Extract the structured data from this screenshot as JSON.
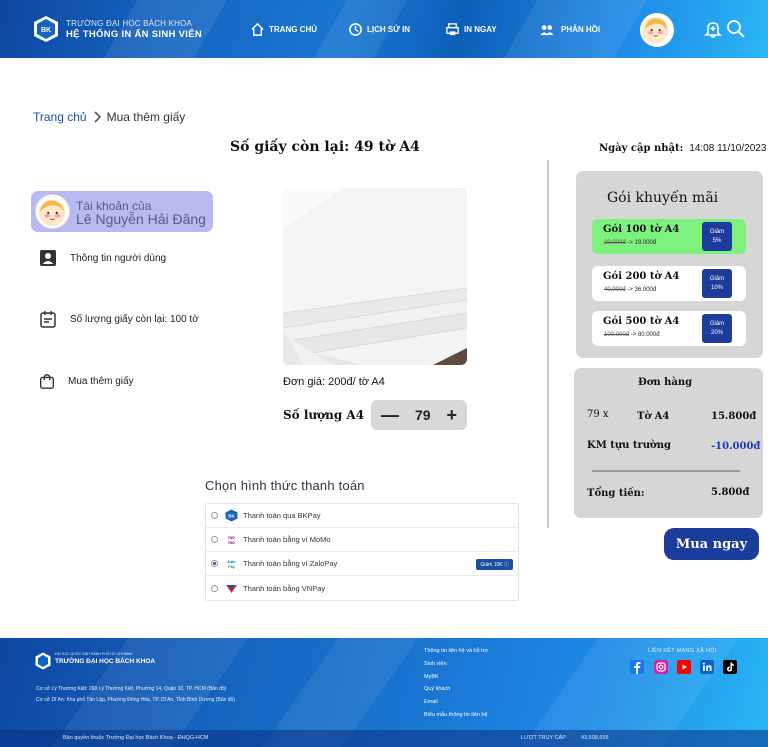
{
  "header": {
    "brand_line1": "TRƯỜNG ĐẠI HỌC BÁCH KHOA",
    "brand_line2": "HỆ THỐNG IN ẤN SINH VIÊN",
    "logo_text": "BK",
    "nav": {
      "home": "TRANG CHỦ",
      "history": "LỊCH SỬ IN",
      "print_now": "IN NGAY",
      "feedback": "PHẢN HỒI"
    }
  },
  "breadcrumb": {
    "home": "Trang chủ",
    "current": "Mua thêm giấy"
  },
  "summary": {
    "remaining": "Số giấy còn lại: 49 tờ A4",
    "updated_label": "Ngày cập nhật:",
    "updated_value": "14:08 11/10/2023"
  },
  "account": {
    "label": "Tài khoản của",
    "name": "Lê Nguyễn Hải Đăng"
  },
  "menu": {
    "user_info": "Thông tin người dùng",
    "paper_left": "Số lượng giấy còn lại: 100 tờ",
    "buy_more": "Mua thêm giấy"
  },
  "product": {
    "unit_price": "Đơn giá: 200đ/ tờ A4",
    "qty_label": "Số lượng A4",
    "qty_minus": "—",
    "qty_value": "79",
    "qty_plus": "+"
  },
  "payment": {
    "title": "Chọn hình thức thanh toán",
    "methods": [
      {
        "label": "Thanh toán qua BKPay",
        "selected": false
      },
      {
        "label": "Thanh toán bằng ví MoMo",
        "selected": false
      },
      {
        "label": "Thanh toán bằng ví ZaloPay",
        "selected": true,
        "promo": "Giảm 10K ⓘ"
      },
      {
        "label": "Thanh toán bằng VNPay",
        "selected": false
      }
    ]
  },
  "promo": {
    "title": "Gói khuyến mãi",
    "packs": [
      {
        "name": "Gói 100 tờ A4",
        "old": "20.000đ",
        "new": "-> 19.000đ",
        "disc1": "Giảm",
        "disc2": "5%",
        "selected": true
      },
      {
        "name": "Gói 200 tờ A4",
        "old": "40.000đ",
        "new": "-> 36.000đ",
        "disc1": "Giảm",
        "disc2": "10%",
        "selected": false
      },
      {
        "name": "Gói 500 tờ A4",
        "old": "100.000đ",
        "new": "-> 80.000đ",
        "disc1": "Giảm",
        "disc2": "20%",
        "selected": false
      }
    ]
  },
  "order": {
    "title": "Đơn hàng",
    "qty": "79 x",
    "item": "Tờ A4",
    "item_price": "15.800đ",
    "discount_label": "KM tựu trường",
    "discount_value": "-10.000đ",
    "total_label": "Tổng tiền:",
    "total_value": "5.800đ",
    "buy_button": "Mua ngay"
  },
  "footer": {
    "uni_line1": "ĐẠI HỌC QUỐC GIA THÀNH PHỐ HỒ CHÍ MINH",
    "uni_line2": "TRƯỜNG ĐẠI HỌC BÁCH KHOA",
    "address1": "Cơ sở Lý Thường Kiệt: 268 Lý Thường Kiệt, Phường 14, Quận 10, TP. HCM (Bản đồ)",
    "address2": "Cơ sở Dĩ An: Khu phố Tân Lập, Phường Đông Hòa, TP. Dĩ An, Tỉnh Bình Dương (Bản đồ)",
    "links": [
      "Thông tin liên hệ và hỗ trợ",
      "Sinh viên",
      "MyBK",
      "Quý khách",
      "Email",
      "Biểu mẫu thông tin liên hệ"
    ],
    "social_title": "LIÊN KẾT MẠNG XÃ HỘI",
    "copyright": "Bản quyền thuộc Trường Đại học Bách Khoa - ĐHQG-HCM",
    "visits_label": "LƯỢT TRUY CẬP",
    "visits_value": "43,508,658"
  },
  "colors": {
    "primary": "#1c3c9b",
    "account_card": "#b9b8f0",
    "panel_grey": "#d6d6d6",
    "selected_pack": "#7ef07e",
    "discount_blue": "#1d3cbd"
  },
  "icons": [
    "home-icon",
    "history-icon",
    "printer-icon",
    "feedback-icon",
    "bell-icon",
    "search-icon",
    "user-card-icon",
    "calendar-icon",
    "shopping-bag-icon",
    "chevron-right-icon"
  ]
}
